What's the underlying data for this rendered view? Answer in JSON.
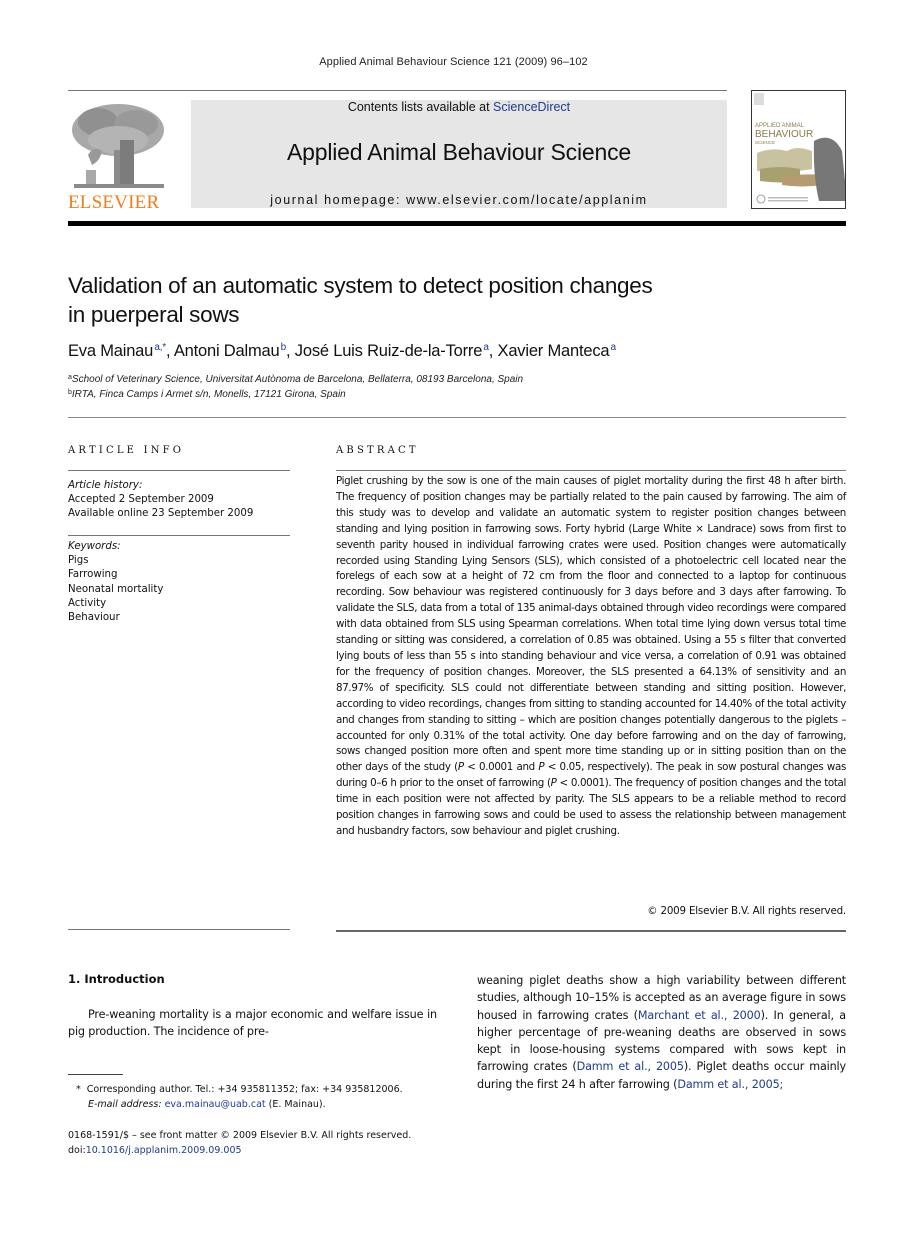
{
  "running_head": "Applied Animal Behaviour Science 121 (2009) 96–102",
  "masthead": {
    "publisher_logo_text": "ELSEVIER",
    "contents_prefix": "Contents lists available at ",
    "contents_link": "ScienceDirect",
    "journal_title": "Applied Animal Behaviour Science",
    "homepage": "journal homepage: www.elsevier.com/locate/applanim",
    "cover_title_lines": [
      "APPLIED ANIMAL",
      "BEHAVIOUR",
      "SCIENCE"
    ]
  },
  "article": {
    "title_line1": "Validation of an automatic system to detect position changes",
    "title_line2": "in puerperal sows",
    "authors": [
      {
        "name": "Eva Mainau",
        "sup": "a,*",
        "sep": ", "
      },
      {
        "name": "Antoni Dalmau",
        "sup": "b",
        "sep": ", "
      },
      {
        "name": "José Luis Ruiz-de-la-Torre",
        "sup": "a",
        "sep": ", "
      },
      {
        "name": "Xavier Manteca",
        "sup": "a",
        "sep": ""
      }
    ],
    "affiliations": [
      {
        "sup": "a",
        "text": "School of Veterinary Science, Universitat Autònoma de Barcelona, Bellaterra, 08193 Barcelona, Spain"
      },
      {
        "sup": "b",
        "text": "IRTA, Finca Camps i Armet s/n, Monells, 17121 Girona, Spain"
      }
    ]
  },
  "article_info": {
    "heading": "ARTICLE INFO",
    "history_label": "Article history:",
    "history": [
      "Accepted 2 September 2009",
      "Available online 23 September 2009"
    ],
    "keywords_label": "Keywords:",
    "keywords": [
      "Pigs",
      "Farrowing",
      "Neonatal mortality",
      "Activity",
      "Behaviour"
    ]
  },
  "abstract": {
    "heading": "ABSTRACT",
    "text_part1": "Piglet crushing by the sow is one of the main causes of piglet mortality during the first 48 h after birth. The frequency of position changes may be partially related to the pain caused by farrowing. The aim of this study was to develop and validate an automatic system to register position changes between standing and lying position in farrowing sows. Forty hybrid (Large White × Landrace) sows from first to seventh parity housed in individual farrowing crates were used. Position changes were automatically recorded using Standing Lying Sensors (SLS), which consisted of a photoelectric cell located near the forelegs of each sow at a height of 72 cm from the floor and connected to a laptop for continuous recording. Sow behaviour was registered continuously for 3 days before and 3 days after farrowing. To validate the SLS, data from a total of 135 animal-days obtained through video recordings were compared with data obtained from SLS using Spearman correlations. When total time lying down versus total time standing or sitting was considered, a correlation of 0.85 was obtained. Using a 55 s filter that converted lying bouts of less than 55 s into standing behaviour and vice versa, a correlation of 0.91 was obtained for the frequency of position changes. Moreover, the SLS presented a 64.13% of sensitivity and an 87.97% of specificity. SLS could not differentiate between standing and sitting position. However, according to video recordings, changes from sitting to standing accounted for 14.40% of the total activity and changes from standing to sitting – which are position changes potentially dangerous to the piglets – accounted for only 0.31% of the total activity. One day before farrowing and on the day of farrowing, sows changed position more often and spent more time standing up or in sitting position than on the other days of the study (",
    "p1": "P",
    "text_part2": " < 0.0001 and ",
    "p2": "P",
    "text_part3": " < 0.05, respectively). The peak in sow postural changes was during 0–6 h prior to the onset of farrowing (",
    "p3": "P",
    "text_part4": " < 0.0001). The frequency of position changes and the total time in each position were not affected by parity. The SLS appears to be a reliable method to record position changes in farrowing sows and could be used to assess the relationship between management and husbandry factors, sow behaviour and piglet crushing.",
    "copyright": "© 2009 Elsevier B.V. All rights reserved."
  },
  "introduction": {
    "heading": "1. Introduction",
    "col1": "Pre-weaning mortality is a major economic and welfare issue in pig production. The incidence of pre-",
    "col2_part1": "weaning piglet deaths show a high variability between different studies, although 10–15% is accepted as an average figure in sows housed in farrowing crates (",
    "cite1": "Marchant et al., 2000",
    "col2_part2": "). In general, a higher percentage of pre-weaning deaths are observed in sows kept in loose-housing systems compared with sows kept in farrowing crates (",
    "cite2": "Damm et al., 2005",
    "col2_part3": "). Piglet deaths occur mainly during the first 24 h after farrowing (",
    "cite3": "Damm et al., 2005;"
  },
  "footnotes": {
    "corresponding_marker": "*",
    "corresponding": "Corresponding author. Tel.: +34 935811352; fax: +34 935812006.",
    "email_label": "E-mail address:",
    "email": "eva.mainau@uab.cat",
    "email_suffix": " (E. Mainau).",
    "issn_line": "0168-1591/$ – see front matter © 2009 Elsevier B.V. All rights reserved.",
    "doi_prefix": "doi:",
    "doi": "10.1016/j.applanim.2009.09.005"
  },
  "colors": {
    "link_blue": "#1f3c8c",
    "elsevier_orange": "#f07d1a",
    "masthead_gray": "#e6e6e6"
  }
}
